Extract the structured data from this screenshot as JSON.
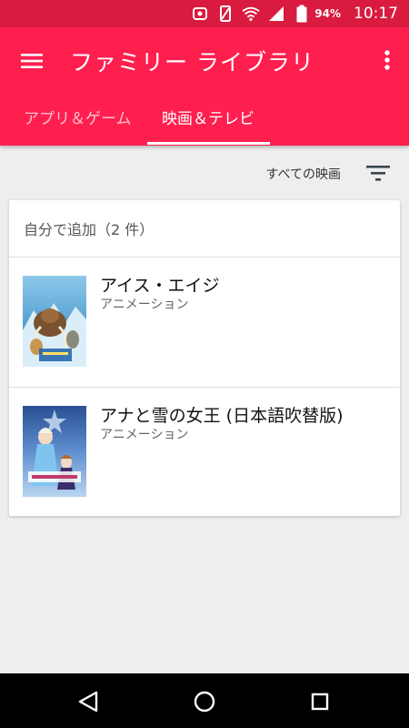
{
  "status_bar": {
    "battery_percent": "94%",
    "time": "10:17"
  },
  "app_bar": {
    "title": "ファミリー ライブラリ",
    "tabs": [
      {
        "label": "アプリ＆ゲーム",
        "selected": false
      },
      {
        "label": "映画＆テレビ",
        "selected": true
      }
    ]
  },
  "filter": {
    "label": "すべての映画"
  },
  "section": {
    "header": "自分で追加（2 件）",
    "items": [
      {
        "title": "アイス・エイジ",
        "genre": "アニメーション"
      },
      {
        "title": "アナと雪の女王 (日本語吹替版)",
        "genre": "アニメーション"
      }
    ]
  },
  "colors": {
    "status_bar": "#d81b3f",
    "app_bar": "#ff1f4f",
    "background": "#eeeeee"
  }
}
